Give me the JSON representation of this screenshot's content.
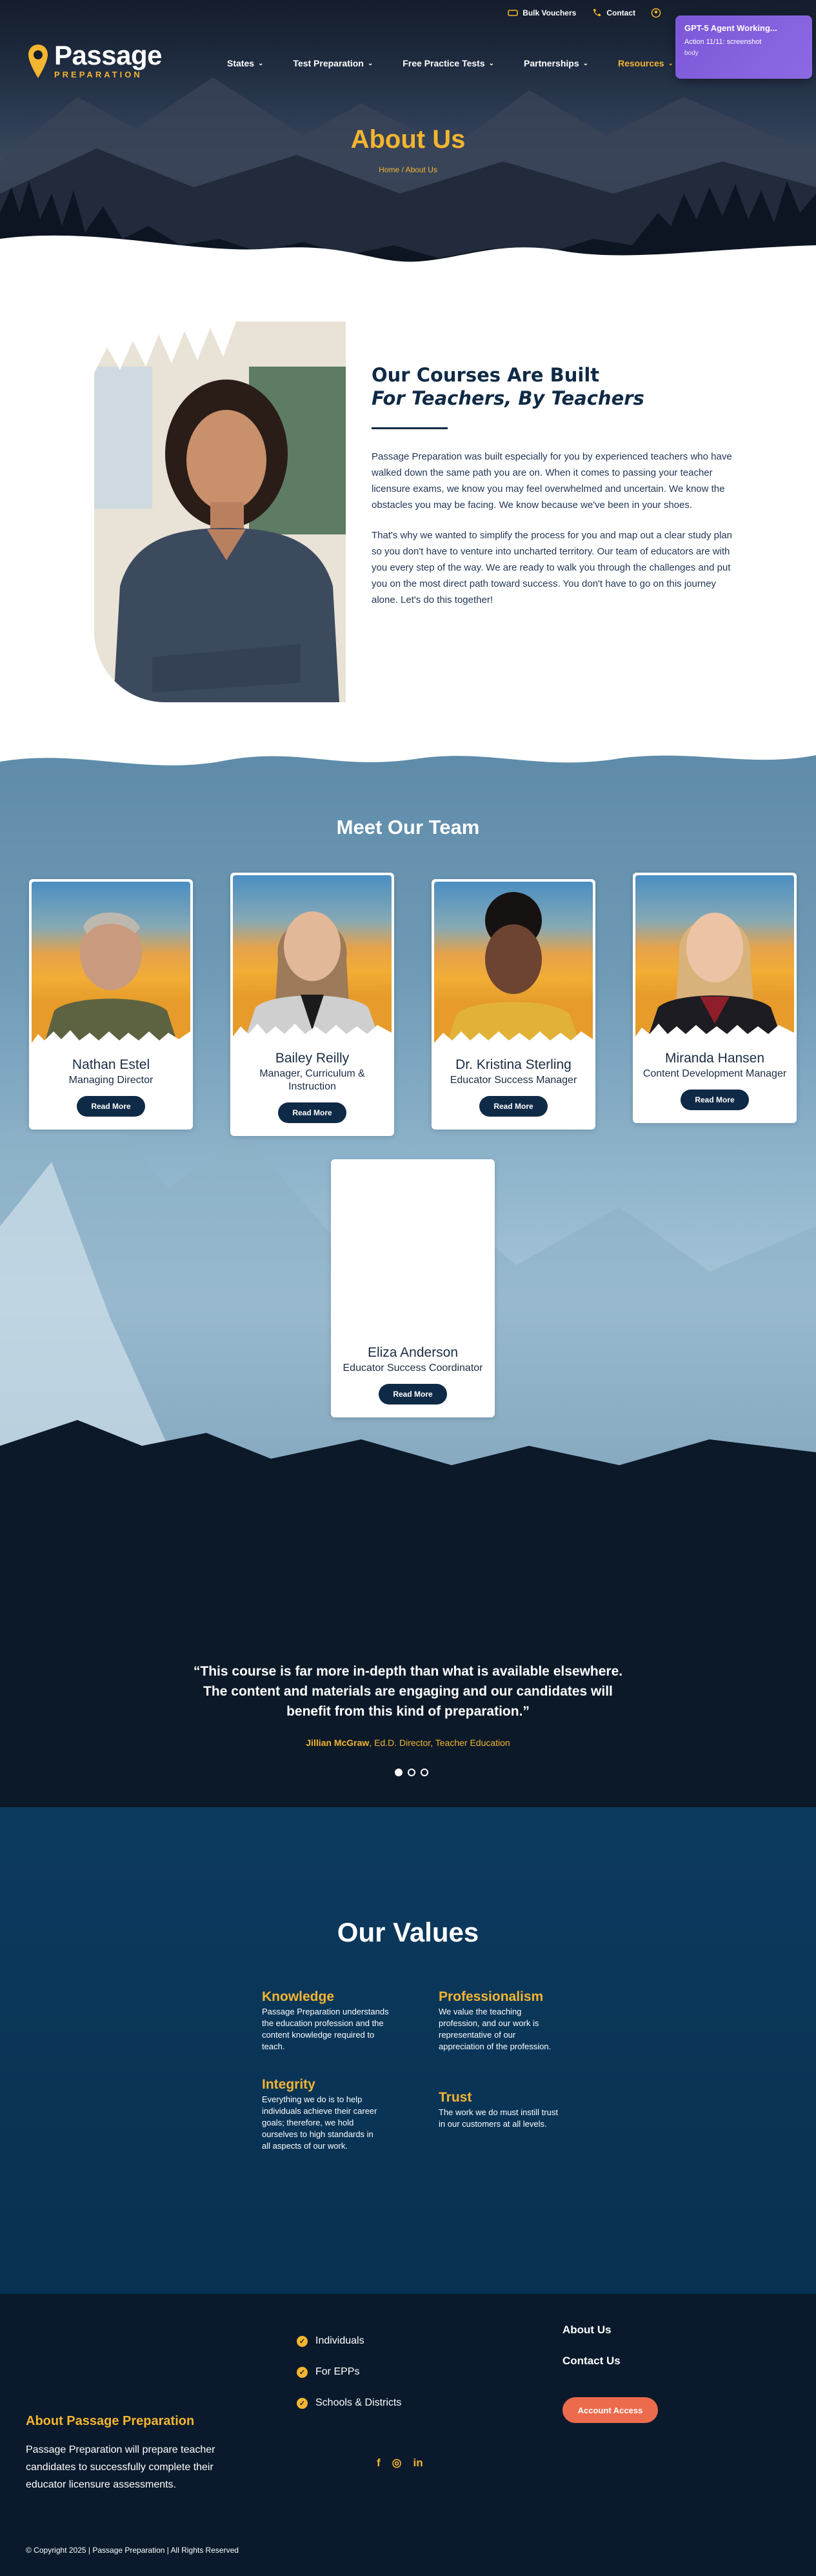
{
  "topbar": {
    "bulk_vouchers": "Bulk Vouchers",
    "contact": "Contact"
  },
  "agent": {
    "title": "GPT-5 Agent Working...",
    "action": "Action 11/11: screenshot",
    "body": "body"
  },
  "logo": {
    "name": "Passage",
    "sub": "PREPARATION"
  },
  "nav": [
    {
      "label": "States"
    },
    {
      "label": "Test Preparation"
    },
    {
      "label": "Free Practice Tests"
    },
    {
      "label": "Partnerships"
    },
    {
      "label": "Resources"
    }
  ],
  "hero": {
    "title": "About Us",
    "crumb_home": "Home",
    "crumb_sep": " / ",
    "crumb_current": "About Us"
  },
  "about": {
    "heading": "Our Courses Are Built",
    "subheading": "For Teachers, By Teachers",
    "p1": "Passage Preparation was built especially for you by experienced teachers who have walked down the same path you are on. When it comes to passing your teacher licensure exams, we know you may feel overwhelmed and uncertain. We know the obstacles you may be facing. We know because we've been in your shoes.",
    "p2": "That's why we wanted to simplify the process for you and map out a clear study plan so you don't have to venture into uncharted territory. Our team of educators are with you every step of the way. We are ready to walk you through the challenges and put you on the most direct path toward success. You don't have to go on this journey alone. Let's do this together!"
  },
  "team": {
    "title": "Meet Our Team",
    "read_more": "Read More",
    "members": [
      {
        "name": "Nathan Estel",
        "role": "Managing Director"
      },
      {
        "name": "Bailey Reilly",
        "role": "Manager, Curriculum & Instruction"
      },
      {
        "name": "Dr. Kristina Sterling",
        "role": "Educator Success Manager"
      },
      {
        "name": "Miranda Hansen",
        "role": "Content Development Manager"
      },
      {
        "name": "Eliza Anderson",
        "role": "Educator Success Coordinator"
      }
    ]
  },
  "testimonial": {
    "quote": "“This course is far more in-depth than what is available elsewhere. The content and materials are engaging and our candidates will benefit from this kind of preparation.”",
    "author": "Jillian McGraw",
    "author_title": ", Ed.D. Director, Teacher Education"
  },
  "values": {
    "title": "Our Values",
    "items": [
      {
        "title": "Knowledge",
        "text": "Passage Preparation understands the education profession and the content knowledge required to teach."
      },
      {
        "title": "Professionalism",
        "text": "We value the teaching profession, and our work is representative of our appreciation of the profession."
      },
      {
        "title": "Integrity",
        "text": "Everything we do is to help individuals achieve their career goals; therefore, we hold ourselves to high standards in all aspects of our work."
      },
      {
        "title": "Trust",
        "text": "The work we do must instill trust in our customers at all levels."
      }
    ]
  },
  "footer": {
    "links": [
      "Individuals",
      "For EPPs",
      "Schools & Districts"
    ],
    "about_us": "About Us",
    "contact_us": "Contact Us",
    "account_access": "Account Access",
    "about_title": "About Passage Preparation",
    "about_text": "Passage Preparation will prepare teacher candidates to successfully complete their educator licensure assessments.",
    "socials": [
      "f",
      "◎",
      "in"
    ],
    "copyright": "© Copyright 2025 | Passage Preparation | All Rights Reserved"
  },
  "colors": {
    "gold": "#f4b530",
    "navy": "#0f2a46",
    "coral": "#ec6b4d",
    "agent_purple": "#7b57d8"
  }
}
